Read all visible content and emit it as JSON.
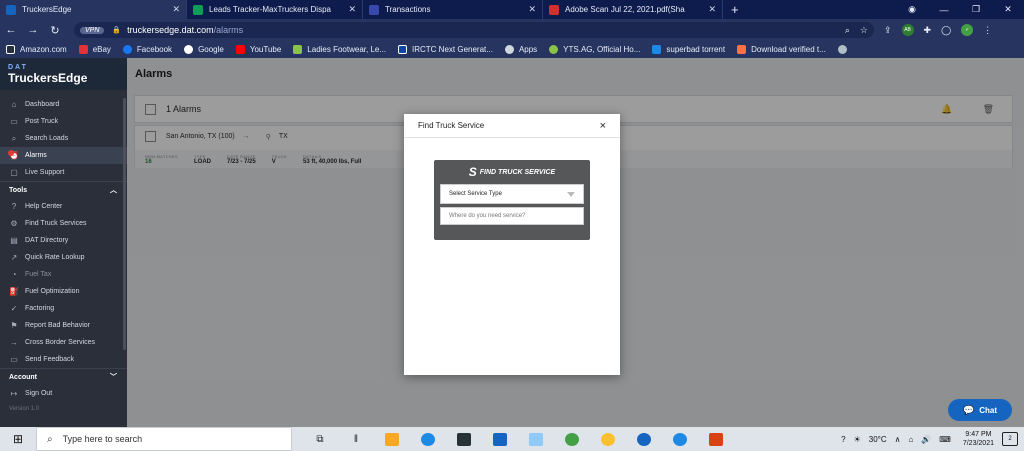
{
  "browser": {
    "tabs": [
      {
        "title": "TruckersEdge",
        "color": "#1565c0",
        "active": true
      },
      {
        "title": "Leads Tracker-MaxTruckers Dispa",
        "color": "#0f9d58",
        "active": false
      },
      {
        "title": "Transactions",
        "color": "#3949ab",
        "active": false
      },
      {
        "title": "Adobe Scan Jul 22, 2021.pdf(Sha",
        "color": "#d32f2f",
        "active": false
      }
    ],
    "new_tab": "+",
    "vpn_label": "VPN",
    "url_host": "truckersedge.dat.com",
    "url_path": "/alarms",
    "bookmarks": [
      {
        "label": "Amazon.com",
        "color": "#232f3e"
      },
      {
        "label": "eBay",
        "color": "#e53238"
      },
      {
        "label": "Facebook",
        "color": "#1877f2"
      },
      {
        "label": "Google",
        "color": "#ffffff"
      },
      {
        "label": "YouTube",
        "color": "#ff0000"
      },
      {
        "label": "Ladies Footwear, Le...",
        "color": "#8bc34a"
      },
      {
        "label": "IRCTC Next Generat...",
        "color": "#0d47a1"
      },
      {
        "label": "Apps",
        "color": "#cfd8dc"
      },
      {
        "label": "YTS.AG, Official Ho...",
        "color": "#8bc34a"
      },
      {
        "label": "superbad torrent",
        "color": "#1e88e5"
      },
      {
        "label": "Download verified t...",
        "color": "#ff7043"
      }
    ]
  },
  "sidebar": {
    "brand_top": "DAT",
    "brand_name": "TruckersEdge",
    "main_items": [
      {
        "label": "Dashboard",
        "icon": "home-icon"
      },
      {
        "label": "Post Truck",
        "icon": "truck-icon"
      },
      {
        "label": "Search Loads",
        "icon": "search-icon"
      },
      {
        "label": "Alarms",
        "icon": "alarm-icon"
      },
      {
        "label": "Live Support",
        "icon": "chat-icon"
      }
    ],
    "tools_header": "Tools",
    "tool_items": [
      {
        "label": "Help Center",
        "icon": "help-icon"
      },
      {
        "label": "Find Truck Services",
        "icon": "wrench-icon"
      },
      {
        "label": "DAT Directory",
        "icon": "book-icon"
      },
      {
        "label": "Quick Rate Lookup",
        "icon": "rate-icon"
      },
      {
        "label": "Fuel Tax",
        "icon": "fuel-tax-icon"
      },
      {
        "label": "Fuel Optimization",
        "icon": "fuel-icon"
      },
      {
        "label": "Factoring",
        "icon": "check-icon"
      },
      {
        "label": "Report Bad Behavior",
        "icon": "flag-icon"
      },
      {
        "label": "Cross Border Services",
        "icon": "border-icon"
      },
      {
        "label": "Send Feedback",
        "icon": "feedback-icon"
      }
    ],
    "account_header": "Account",
    "account_items": [
      {
        "label": "Sign Out",
        "icon": "signout-icon"
      }
    ],
    "version": "Version 1.0"
  },
  "main": {
    "page_title": "Alarms",
    "alarms_count": "1 Alarms",
    "alarm": {
      "origin": "San Antonio, TX (100)",
      "destination": "TX",
      "new_matches_label": "NEW MATCHES",
      "new_matches": "16",
      "type_label": "TYPE",
      "type": "LOAD",
      "date_range_label": "DATE RANGE",
      "date_range": "7/23 - 7/25",
      "truck_label": "TRUCK",
      "truck": "V",
      "details_label": "DETAILS",
      "details": "53 ft, 40,000 lbs, Full"
    }
  },
  "modal": {
    "title": "Find Truck Service",
    "close": "×",
    "widget_logo": "FIND TRUCK SERVICE",
    "service_select": "Select Service Type",
    "location_placeholder": "Where do you need service?"
  },
  "chat": {
    "label": "Chat"
  },
  "taskbar": {
    "search_placeholder": "Type here to search",
    "temperature": "30°C",
    "time": "9:47 PM",
    "date": "7/23/2021",
    "notifications": "2"
  }
}
